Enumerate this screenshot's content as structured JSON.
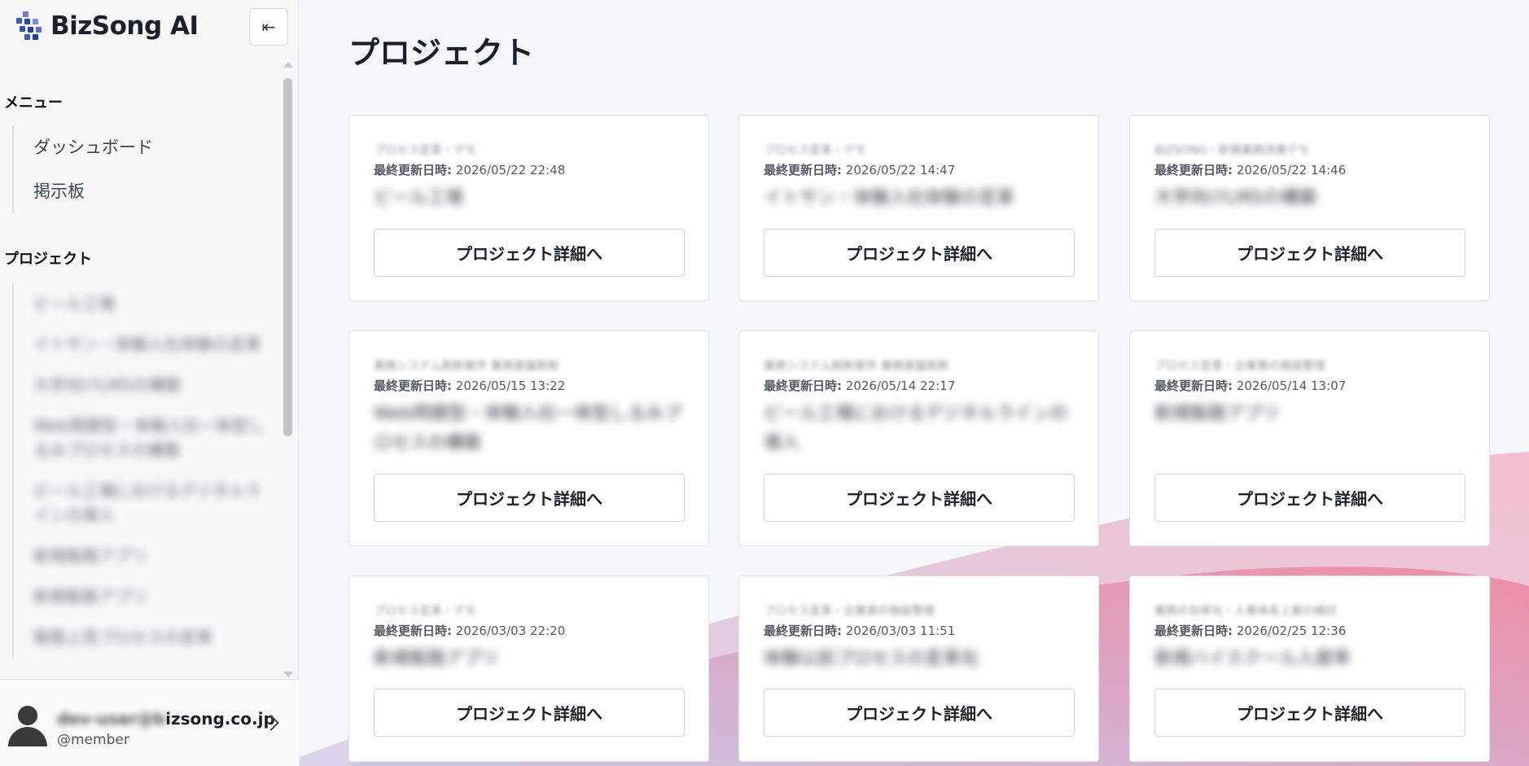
{
  "app": {
    "name": "BizSong AI"
  },
  "sidebar": {
    "collapse_icon": "⇤",
    "menu_title": "メニュー",
    "menu_items": [
      {
        "label": "ダッシュボード"
      },
      {
        "label": "掲示板"
      }
    ],
    "projects_title": "プロジェクト",
    "projects": [
      {
        "label": "ビール工場"
      },
      {
        "label": "イトサン・体験入社体験の変革"
      },
      {
        "label": "大学向けLMSの構築"
      },
      {
        "label": "Web問題型・体験入社一体型しるみプロセスの構築"
      },
      {
        "label": "ビール工場におけるデジタルラインの導入"
      },
      {
        "label": "新規販路アプリ"
      },
      {
        "label": "新規販路アプリ"
      },
      {
        "label": "販路上見プロセスの変革"
      }
    ]
  },
  "user": {
    "email_hidden": "dev-user@b",
    "email_visible": "izsong.co.jp",
    "role": "@member"
  },
  "main": {
    "title": "プロジェクト",
    "date_label": "最終更新日時:",
    "button_label": "プロジェクト詳細へ",
    "cards": [
      {
        "category": "プロセス変革・デモ",
        "date": "2026/05/22 22:48",
        "name": "ビール工場"
      },
      {
        "category": "プロセス変革・デモ",
        "date": "2026/05/22 14:47",
        "name": "イトサン・体験入社体験の変革"
      },
      {
        "category": "BIZSONG・新規業務改善デモ",
        "date": "2026/05/22 14:46",
        "name": "大学向けLMSの構築"
      },
      {
        "category": "業務システム刷新案件 業務基盤刷新",
        "date": "2026/05/15 13:22",
        "name": "Web問題型・体験入社一体型しるみプロセスの構築"
      },
      {
        "category": "業務システム刷新案件 業務基盤刷新",
        "date": "2026/05/14 22:17",
        "name": "ビール工場におけるデジタルラインの導入"
      },
      {
        "category": "プロセス変革・企業第の施設整理",
        "date": "2026/05/14 13:07",
        "name": "新規販路アプリ"
      },
      {
        "category": "プロセス変革・デモ",
        "date": "2026/03/03 22:20",
        "name": "新規販路アプリ"
      },
      {
        "category": "プロセス変革・企業第の施設整理",
        "date": "2026/03/03 11:51",
        "name": "体験以前プロセスの変革化"
      },
      {
        "category": "業務の効率化・人事体系上案の検討",
        "date": "2026/02/25 12:36",
        "name": "新規ハイスクール入居率"
      }
    ]
  },
  "colors": {
    "accent_pink": "#e98aa3",
    "accent_lavender": "#c9c2e0",
    "logo_blue": "#2f4fa8"
  }
}
